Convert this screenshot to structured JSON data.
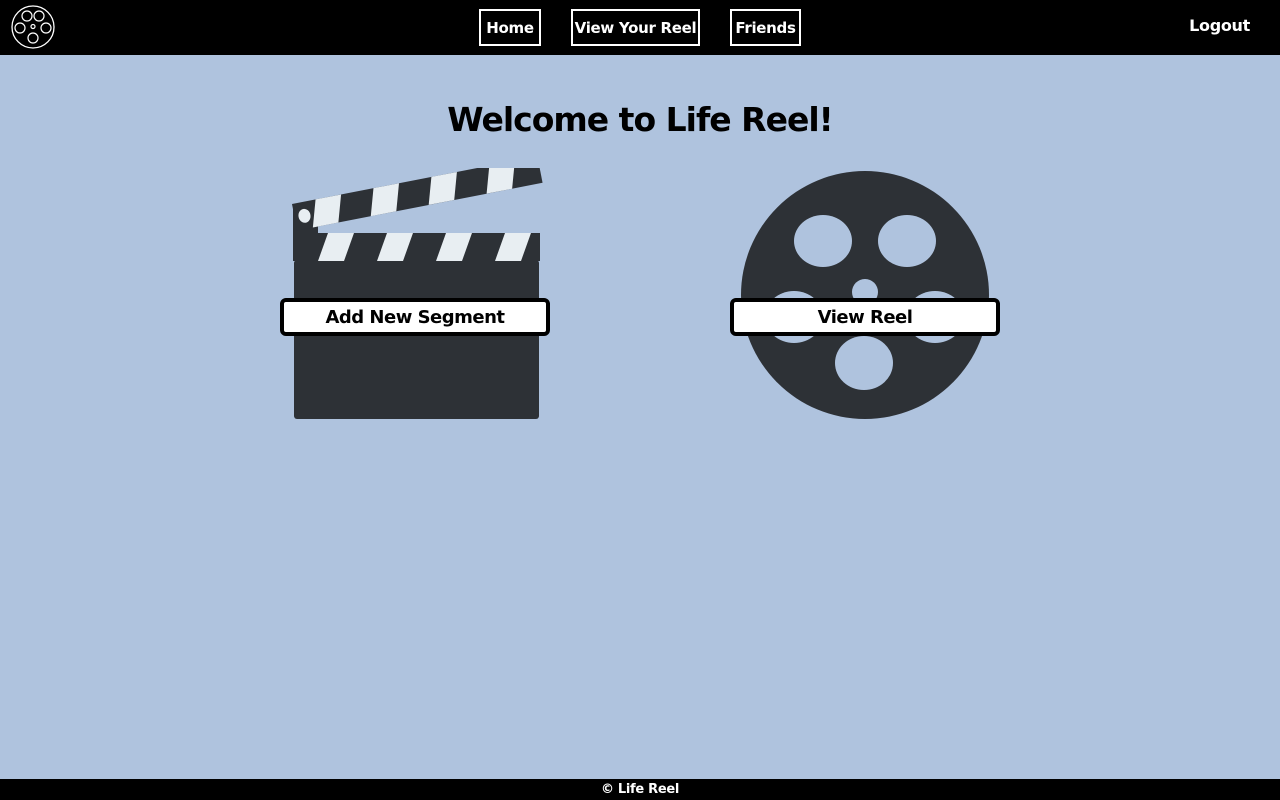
{
  "nav": {
    "logo_icon": "film-reel-icon",
    "links": [
      {
        "label": "Home"
      },
      {
        "label": "View Your Reel"
      },
      {
        "label": "Friends"
      }
    ],
    "logout_label": "Logout"
  },
  "main": {
    "title": "Welcome to Life Reel!",
    "cards": [
      {
        "icon": "clapperboard-icon",
        "button_label": "Add New Segment"
      },
      {
        "icon": "film-reel-icon",
        "button_label": "View Reel"
      }
    ]
  },
  "footer": {
    "text": "© Life Reel"
  },
  "colors": {
    "background": "#afc3de",
    "navbar": "#000000",
    "icon_fill": "#2d3136",
    "clapper_stripe": "#e8eef2"
  }
}
